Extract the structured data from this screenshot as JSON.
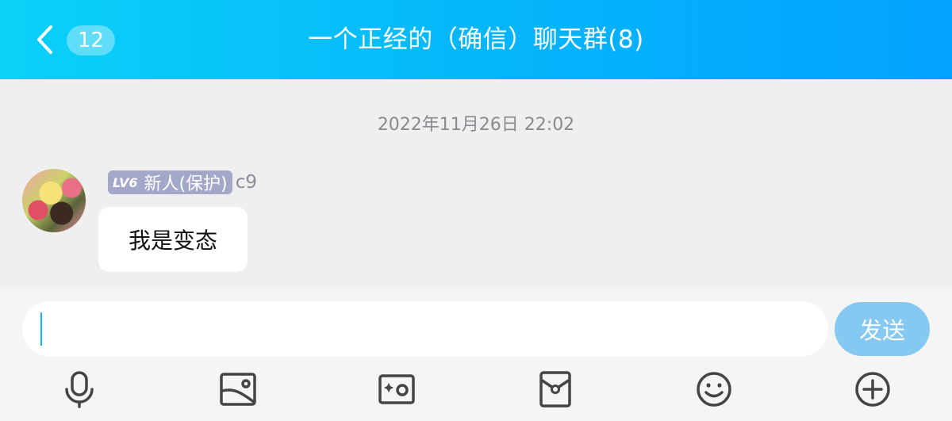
{
  "header": {
    "unread_count": "12",
    "title": "一个正经的（确信）聊天群(8)"
  },
  "chat": {
    "timestamp": "2022年11月26日 22:02",
    "messages": [
      {
        "level": "LV6",
        "badge": "新人(保护)",
        "nickname": "c9",
        "text": "我是变态"
      }
    ]
  },
  "input": {
    "value": "",
    "send_label": "发送"
  },
  "toolbar": {
    "icons": [
      "microphone-icon",
      "image-icon",
      "camera-icon",
      "red-packet-icon",
      "emoji-icon",
      "plus-icon"
    ]
  },
  "colors": {
    "header_gradient_start": "#0bd1f8",
    "header_gradient_end": "#03a2ff",
    "send_button": "#85c9f3",
    "caret": "#13b4ff",
    "level_tag": "#a3a8c9"
  }
}
